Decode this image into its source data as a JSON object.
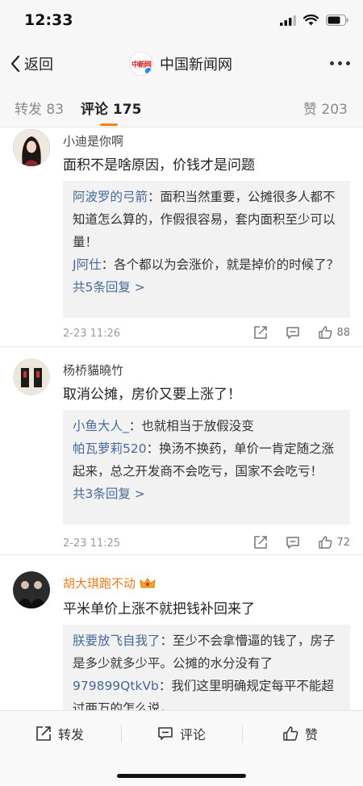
{
  "status_bar": {
    "time": "12:33",
    "icons": [
      "signal-icon",
      "wifi-icon",
      "battery-icon"
    ]
  },
  "nav": {
    "back_label": "返回",
    "account_name": "中国新闻网",
    "logo_text": "中新网"
  },
  "tabs": [
    {
      "label": "转发 83",
      "active": false
    },
    {
      "label": "评论 175",
      "active": true
    },
    {
      "label": "赞 203",
      "active": false
    }
  ],
  "comments": [
    {
      "username": "小迪是你啊",
      "text": "面积不是啥原因，价钱才是问题",
      "replies": [
        {
          "name": "阿波罗的弓箭",
          "text": "：面积当然重要，公摊很多人都不知道怎么算的，作假很容易，套内面积至少可以量！"
        },
        {
          "name": "J阿仕",
          "text": "：各个都以为会涨价，就是掉价的时候了？"
        }
      ],
      "more_replies": "共5条回复 >",
      "time": "2-23 11:26",
      "likes": "88"
    },
    {
      "username": "杨桥貓曉竹",
      "text": "取消公摊，房价又要上涨了！",
      "replies": [
        {
          "name": "小鱼大人_",
          "text": "：也就相当于放假没变"
        },
        {
          "name": "帕瓦萝莉520",
          "text": "：换汤不换药，单价一肯定随之涨起来，总之开发商不会吃亏，国家不会吃亏！"
        }
      ],
      "more_replies": "共3条回复 >",
      "time": "2-23 11:25",
      "likes": "72"
    },
    {
      "username": "胡大琪跑不动",
      "text": "平米单价上涨不就把钱补回来了",
      "replies": [
        {
          "name": "朕要放飞自我了",
          "text": "：至少不会拿懵逼的钱了，房子是多少就多少平。公摊的水分没有了"
        },
        {
          "name": "979899QtkVb",
          "text": "：我们这里明确规定每平不能超过两万的怎么说，"
        }
      ]
    }
  ],
  "bottom_bar": {
    "repost": "转发",
    "comment": "评论",
    "like": "赞"
  },
  "colors": {
    "accent": "#ff8200",
    "link": "#486a98",
    "vip_name": "#ea7a18"
  }
}
